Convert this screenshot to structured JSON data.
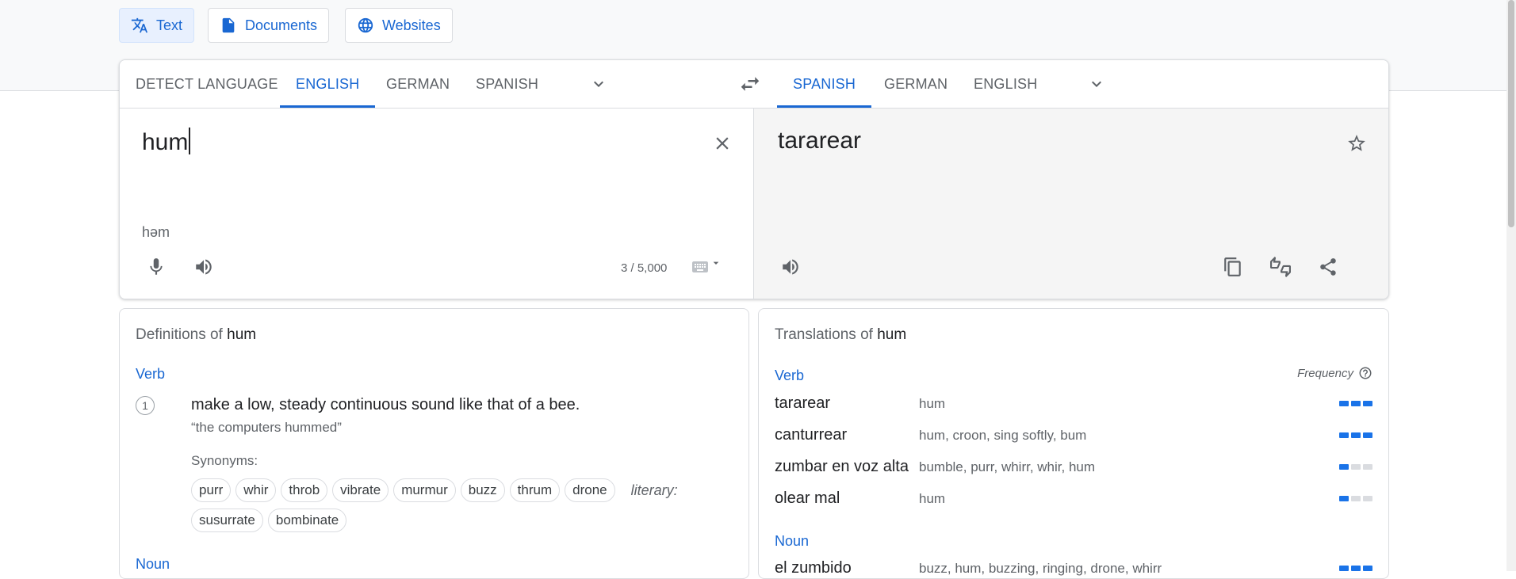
{
  "modes": [
    {
      "label": "Text",
      "icon": "translate-icon"
    },
    {
      "label": "Documents",
      "icon": "document-icon"
    },
    {
      "label": "Websites",
      "icon": "globe-icon"
    }
  ],
  "source_langs": [
    "DETECT LANGUAGE",
    "ENGLISH",
    "GERMAN",
    "SPANISH"
  ],
  "target_langs": [
    "SPANISH",
    "GERMAN",
    "ENGLISH"
  ],
  "source": {
    "text": "hum",
    "phonetic": "həm",
    "counter": "3 / 5,000"
  },
  "target": {
    "text": "tararear"
  },
  "definitions": {
    "title_prefix": "Definitions of",
    "word": "hum",
    "pos": "Verb",
    "pos2": "Noun",
    "number": "1",
    "definition": "make a low, steady continuous sound like that of a bee.",
    "example": "“the computers hummed”",
    "synonyms_label": "Synonyms:",
    "synonyms": [
      "purr",
      "whir",
      "throb",
      "vibrate",
      "murmur",
      "buzz",
      "thrum",
      "drone"
    ],
    "literary_label": "literary:",
    "literary_synonyms": [
      "susurrate",
      "bombinate"
    ]
  },
  "translations": {
    "title_prefix": "Translations of",
    "word": "hum",
    "pos": "Verb",
    "pos2": "Noun",
    "frequency_label": "Frequency",
    "verb_rows": [
      {
        "word": "tararear",
        "synonyms": "hum",
        "frequency": 3
      },
      {
        "word": "canturrear",
        "synonyms": "hum, croon, sing softly, bum",
        "frequency": 3
      },
      {
        "word": "zumbar en voz alta",
        "synonyms": "bumble, purr, whirr, whir, hum",
        "frequency": 1
      },
      {
        "word": "olear mal",
        "synonyms": "hum",
        "frequency": 1
      }
    ],
    "noun_rows": [
      {
        "word": "el zumbido",
        "synonyms": "buzz, hum, buzzing, ringing, drone, whirr",
        "frequency": 3
      }
    ]
  },
  "colors": {
    "accent": "#1967d2",
    "freq_on": "#1a73e8",
    "freq_off": "#dadce0"
  }
}
